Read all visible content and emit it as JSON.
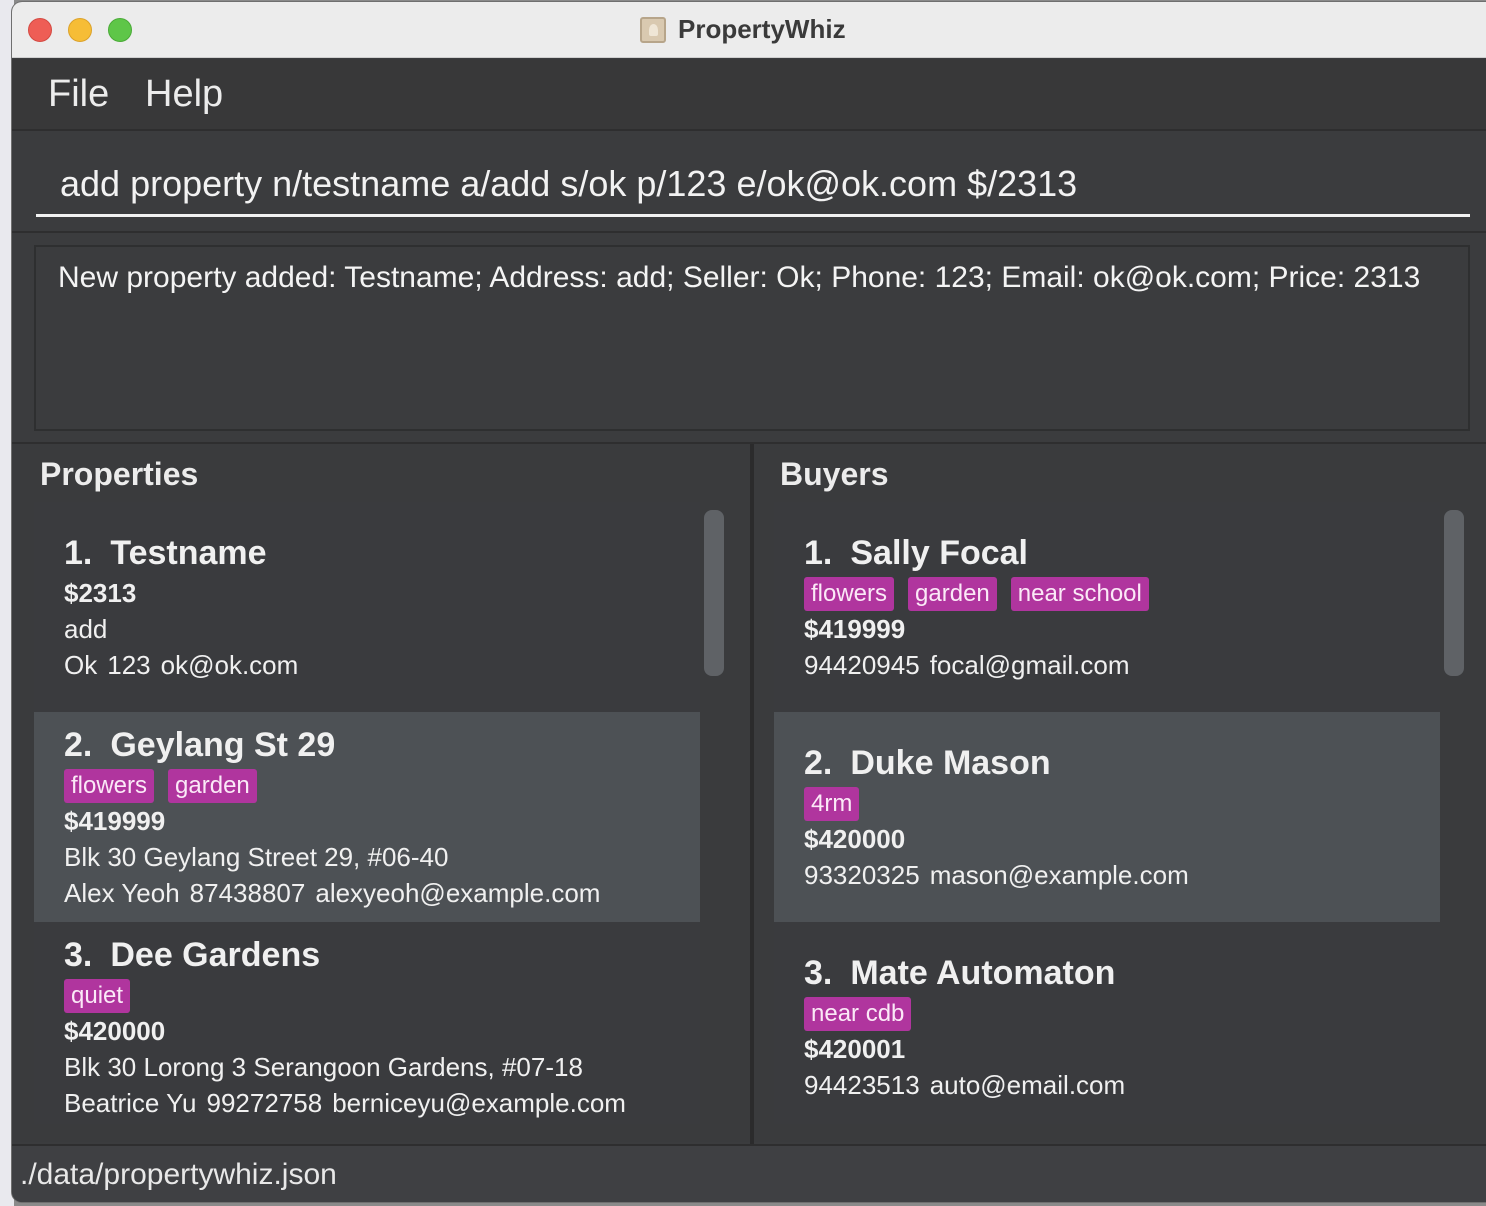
{
  "window": {
    "title": "PropertyWhiz"
  },
  "menu": {
    "file": "File",
    "help": "Help"
  },
  "command": {
    "value": "add property n/testname a/add s/ok p/123 e/ok@ok.com $/2313"
  },
  "result": {
    "text": "New property added: Testname; Address: add; Seller: Ok; Phone: 123; Email: ok@ok.com; Price: 2313"
  },
  "properties": {
    "title": "Properties",
    "items": [
      {
        "index": "1.",
        "name": "Testname",
        "tags": [],
        "price": "$2313",
        "address": "add",
        "seller": "Ok",
        "phone": "123",
        "email": "ok@ok.com"
      },
      {
        "index": "2.",
        "name": "Geylang St 29",
        "tags": [
          "flowers",
          "garden"
        ],
        "price": "$419999",
        "address": "Blk 30 Geylang Street 29, #06-40",
        "seller": "Alex Yeoh",
        "phone": "87438807",
        "email": "alexyeoh@example.com"
      },
      {
        "index": "3.",
        "name": "Dee Gardens",
        "tags": [
          "quiet"
        ],
        "price": "$420000",
        "address": "Blk 30 Lorong 3 Serangoon Gardens, #07-18",
        "seller": "Beatrice Yu",
        "phone": "99272758",
        "email": "berniceyu@example.com"
      }
    ]
  },
  "buyers": {
    "title": "Buyers",
    "items": [
      {
        "index": "1.",
        "name": "Sally Focal",
        "tags": [
          "flowers",
          "garden",
          "near school"
        ],
        "price": "$419999",
        "phone": "94420945",
        "email": "focal@gmail.com"
      },
      {
        "index": "2.",
        "name": "Duke Mason",
        "tags": [
          "4rm"
        ],
        "price": "$420000",
        "phone": "93320325",
        "email": "mason@example.com"
      },
      {
        "index": "3.",
        "name": "Mate Automaton",
        "tags": [
          "near cdb"
        ],
        "price": "$420001",
        "phone": "94423513",
        "email": "auto@email.com"
      }
    ]
  },
  "status": {
    "path": "./data/propertywhiz.json"
  },
  "colors": {
    "tag_bg": "#b0359e",
    "window_bg": "#3b3c3e",
    "selected_card": "#4d5155"
  }
}
